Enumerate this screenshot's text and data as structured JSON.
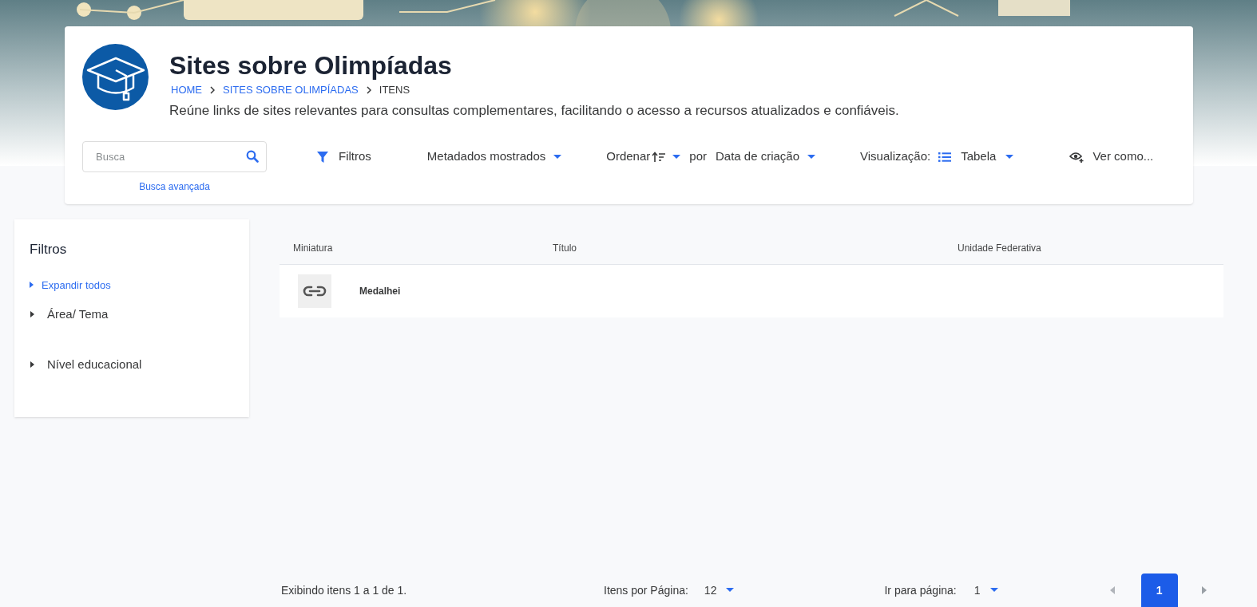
{
  "header": {
    "title": "Sites sobre Olimpíadas",
    "breadcrumb": [
      {
        "label": "HOME",
        "current": false
      },
      {
        "label": "SITES SOBRE OLIMPÍADAS",
        "current": false
      },
      {
        "label": "ITENS",
        "current": true
      }
    ],
    "description": "Reúne links de sites relevantes para consultas complementares, facilitando o acesso a recursos atualizados e confiáveis."
  },
  "search": {
    "placeholder": "Busca",
    "advanced_link": "Busca avançada"
  },
  "toolbar": {
    "filters_button": "Filtros",
    "metadata_dropdown": "Metadados mostrados",
    "sort_label": "Ordenar",
    "sort_by_label": "por",
    "sort_field": "Data de criação",
    "view_label": "Visualização:",
    "view_mode": "Tabela",
    "view_as": "Ver como..."
  },
  "filters_panel": {
    "title": "Filtros",
    "expand_all": "Expandir todos",
    "groups": [
      {
        "label": "Área/ Tema",
        "expanded": false
      },
      {
        "label": "Nível educacional",
        "expanded": false
      }
    ]
  },
  "table": {
    "columns": [
      "Miniatura",
      "Título",
      "Unidade Federativa"
    ],
    "rows": [
      {
        "title": "Medalhei"
      }
    ]
  },
  "footer": {
    "showing": "Exibindo itens 1 a 1 de 1.",
    "per_page_label": "Itens por Página:",
    "per_page_value": "12",
    "goto_label": "Ir para página:",
    "goto_value": "1",
    "pages": [
      {
        "label": "1",
        "selected": true
      }
    ]
  }
}
